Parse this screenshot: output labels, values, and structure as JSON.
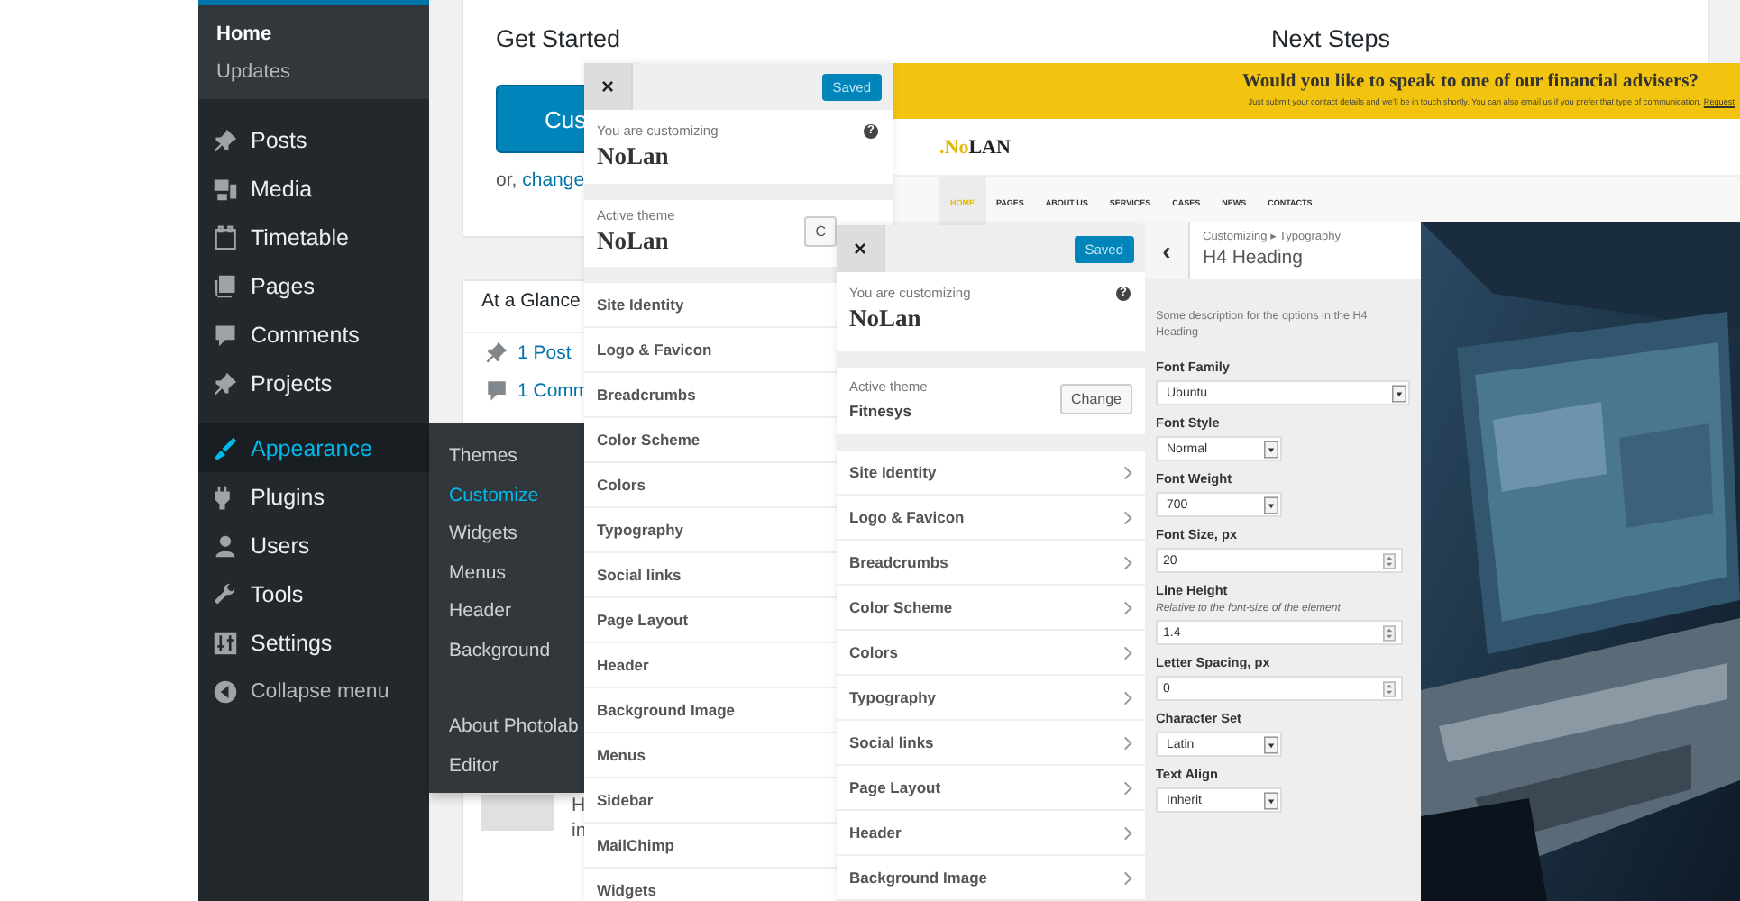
{
  "admin_menu": {
    "submenu": [
      {
        "label": "Home",
        "selected": true
      },
      {
        "label": "Updates",
        "selected": false
      }
    ],
    "items": [
      {
        "label": "Posts",
        "selected": false
      },
      {
        "label": "Media",
        "selected": false
      },
      {
        "label": "Timetable",
        "selected": false
      },
      {
        "label": "Pages",
        "selected": false
      },
      {
        "label": "Comments",
        "selected": false
      },
      {
        "label": "Projects",
        "selected": false
      },
      {
        "label": "Appearance",
        "selected": true
      },
      {
        "label": "Plugins",
        "selected": false
      },
      {
        "label": "Users",
        "selected": false
      },
      {
        "label": "Tools",
        "selected": false
      },
      {
        "label": "Settings",
        "selected": false
      }
    ],
    "collapse": "Collapse menu",
    "flyout": [
      [
        {
          "label": "Themes",
          "selected": false
        },
        {
          "label": "Customize",
          "selected": true
        },
        {
          "label": "Widgets",
          "selected": false
        },
        {
          "label": "Menus",
          "selected": false
        },
        {
          "label": "Header",
          "selected": false
        },
        {
          "label": "Background",
          "selected": false
        }
      ],
      [
        {
          "label": "About Photolab",
          "selected": false
        },
        {
          "label": "Editor",
          "selected": false
        }
      ]
    ]
  },
  "dashboard": {
    "get_started": {
      "title": "Get Started",
      "button": "Cus",
      "prefix": "or,",
      "link": "change"
    },
    "next_steps": "Next Steps",
    "at_a_glance": {
      "title": "At a Glance",
      "items": [
        "1 Post",
        "1 Comm"
      ]
    },
    "activity": [
      "H",
      "in"
    ]
  },
  "customizer_panels": [
    {
      "close": "×",
      "save": "Saved",
      "customizing_label": "You are customizing",
      "site_name": "NoLan",
      "help": "?",
      "theme_label": "Active theme",
      "theme": "NoLan",
      "serif_theme": true,
      "change": "C",
      "chevrons": false,
      "sections": [
        "Site Identity",
        "Logo & Favicon",
        "Breadcrumbs",
        "Color Scheme",
        "Colors",
        "Typography",
        "Social links",
        "Page Layout",
        "Header",
        "Background Image",
        "Menus",
        "Sidebar",
        "MailChimp",
        "Widgets"
      ]
    },
    {
      "close": "×",
      "save": "Saved",
      "customizing_label": "You are customizing",
      "site_name": "NoLan",
      "help": "?",
      "theme_label": "Active theme",
      "theme": "Fitnesys",
      "serif_theme": false,
      "change": "Change",
      "chevrons": true,
      "sections": [
        "Site Identity",
        "Logo & Favicon",
        "Breadcrumbs",
        "Color Scheme",
        "Colors",
        "Typography",
        "Social links",
        "Page Layout",
        "Header",
        "Background Image"
      ]
    }
  ],
  "preview": {
    "banner_title": "Would you like to speak to one of our financial advisers?",
    "banner_text": "Just submit your contact details and we'll be in touch shortly. You can also email us if you prefer that type of communication.",
    "banner_link": "Request",
    "logo_accent": ".No",
    "logo_rest": "LAN",
    "nav": [
      {
        "label": "HOME",
        "selected": true
      },
      {
        "label": "PAGES",
        "selected": false
      },
      {
        "label": "ABOUT US",
        "selected": false
      },
      {
        "label": "SERVICES",
        "selected": false
      },
      {
        "label": "CASES",
        "selected": false
      },
      {
        "label": "NEWS",
        "selected": false
      },
      {
        "label": "CONTACTS",
        "selected": false
      }
    ]
  },
  "typography_panel": {
    "back": "‹",
    "breadcrumb": "Customizing ▸ Typography",
    "title": "H4 Heading",
    "description": "Some description for the options in the H4 Heading",
    "controls": [
      {
        "kind": "select-wide",
        "label": "Font Family",
        "value": "Ubuntu"
      },
      {
        "kind": "select",
        "label": "Font Style",
        "value": "Normal"
      },
      {
        "kind": "select",
        "label": "Font Weight",
        "value": "700"
      },
      {
        "kind": "number",
        "label": "Font Size, px",
        "value": "20"
      },
      {
        "kind": "number",
        "label": "Line Height",
        "hint": "Relative to the font-size of the element",
        "value": "1.4"
      },
      {
        "kind": "number",
        "label": "Letter Spacing, px",
        "value": "0"
      },
      {
        "kind": "select",
        "label": "Character Set",
        "value": "Latin"
      },
      {
        "kind": "select",
        "label": "Text Align",
        "value": "Inherit"
      }
    ]
  }
}
